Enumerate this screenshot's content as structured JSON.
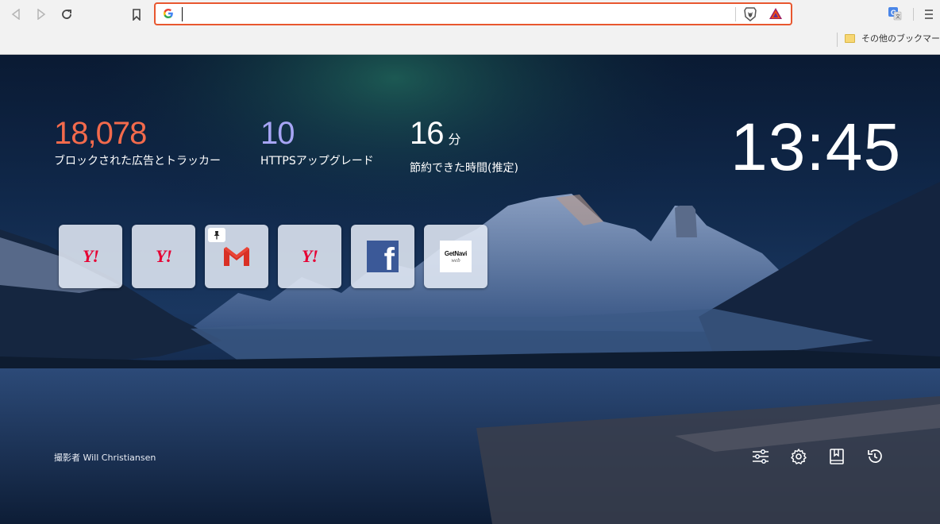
{
  "browser": {
    "address_bar": {
      "value": "",
      "placeholder": ""
    },
    "search_engine_icon": "google-g-icon",
    "bookmarks_bar": {
      "other_bookmarks_label": "その他のブックマーク"
    }
  },
  "stats": {
    "blocked": {
      "value": "18,078",
      "label": "ブロックされた広告とトラッカー",
      "color": "#f36a4c"
    },
    "https": {
      "value": "10",
      "label": "HTTPSアップグレード",
      "color": "#a7a5f5"
    },
    "time_saved": {
      "value": "16",
      "unit": "分",
      "label": "節約できた時間(推定)",
      "color": "#ffffff"
    }
  },
  "clock": {
    "time": "13:45"
  },
  "top_sites": [
    {
      "name": "yahoo",
      "logo_text": "Y!"
    },
    {
      "name": "yahoo",
      "logo_text": "Y!"
    },
    {
      "name": "gmail",
      "logo_text": "M",
      "pinned": true
    },
    {
      "name": "yahoo",
      "logo_text": "Y!"
    },
    {
      "name": "facebook",
      "logo_text": "f"
    },
    {
      "name": "getnavi-web",
      "logo_text": "GetNavi",
      "logo_subtext": "web"
    }
  ],
  "photo_credit": "撮影者 Will Christiansen",
  "colors": {
    "accent": "#e8572f",
    "brave_orange": "#fb542b"
  }
}
